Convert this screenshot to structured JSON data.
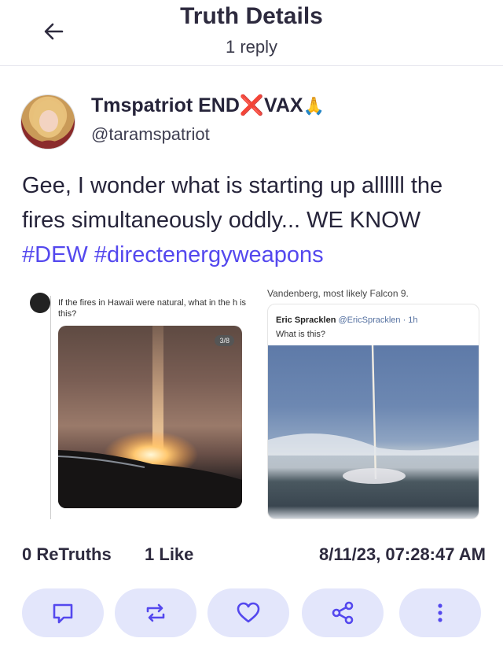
{
  "header": {
    "title": "Truth Details",
    "subtitle": "1 reply",
    "back_icon": "arrow-left-icon"
  },
  "post": {
    "author": {
      "display_name_prefix": "Tmspatriot END",
      "display_name_x": "❌",
      "display_name_suffix": "VAX",
      "display_name_emoji": "🙏",
      "handle": "@taramspatriot"
    },
    "text_plain": "Gee, I wonder what is starting up allllll the fires simultaneously oddly... WE KNOW",
    "hashtags": [
      "#DEW",
      "#directenergyweapons"
    ],
    "media": {
      "left": {
        "caption": "If the fires in Hawaii were natural, what in the h is this?",
        "badge": "3/8"
      },
      "right": {
        "top_text": "Vandenberg, most likely Falcon 9.",
        "author": "Eric Spracklen",
        "handle": "@EricSpracklen · 1h",
        "question": "What is this?"
      }
    },
    "stats": {
      "retruths_count": "0",
      "retruths_label": "ReTruths",
      "likes_count": "1",
      "likes_label": "Like",
      "timestamp": "8/11/23, 07:28:47 AM"
    }
  },
  "actions": [
    {
      "name": "reply-button",
      "icon": "comment-icon"
    },
    {
      "name": "retruth-button",
      "icon": "repost-icon"
    },
    {
      "name": "like-button",
      "icon": "heart-icon"
    },
    {
      "name": "share-button",
      "icon": "share-icon"
    },
    {
      "name": "more-button",
      "icon": "more-vertical-icon"
    }
  ],
  "colors": {
    "accent": "#5448ee",
    "action_bg": "#e3e6fb",
    "action_icon": "#5448ee",
    "x_red": "#d6261f"
  }
}
